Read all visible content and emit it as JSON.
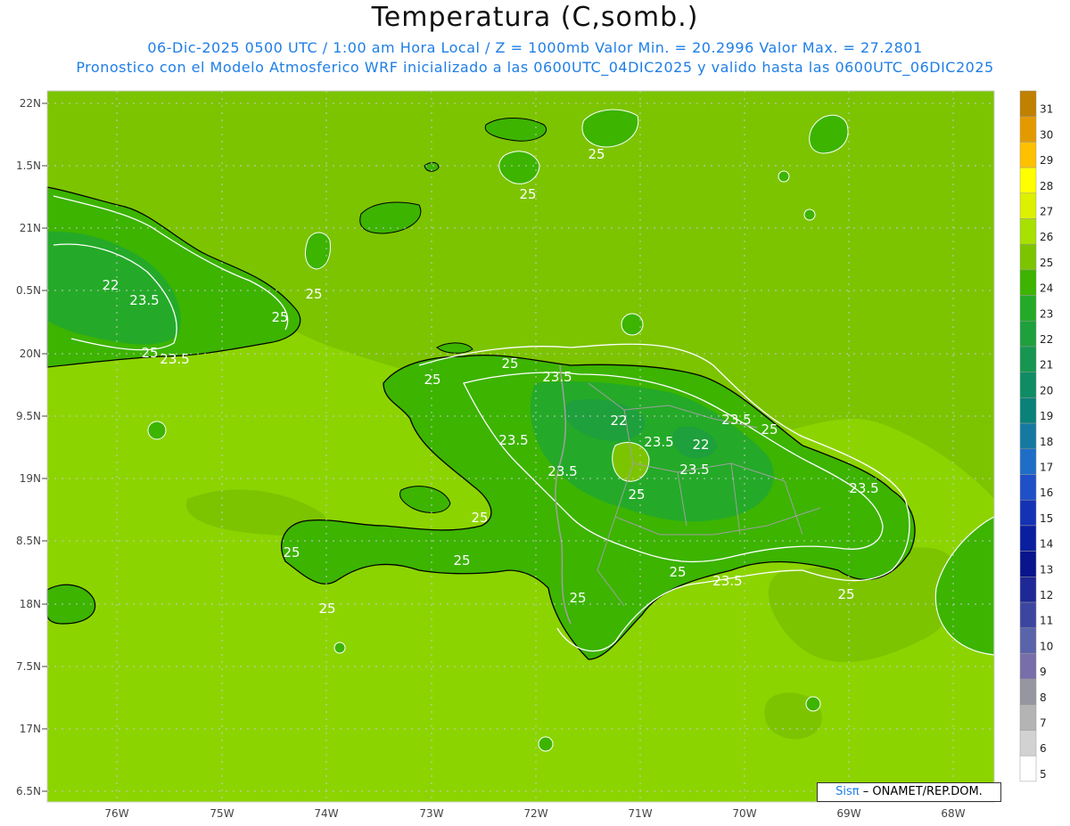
{
  "title": "Temperatura (C,somb.)",
  "subtitle_line1": "06-Dic-2025  0500 UTC / 1:00 am Hora Local / Z = 1000mb   Valor Min. = 20.2996  Valor Max. = 27.2801",
  "subtitle_line2": "Pronostico con el Modelo Atmosferico WRF inicializado a las 0600UTC_04DIC2025 y valido hasta las  0600UTC_06DIC2025",
  "credit": {
    "logo": "Sisπ",
    "text": "– ONAMET/REP.DOM."
  },
  "y_axis_labels": [
    "22N",
    "1.5N",
    "21N",
    "0.5N",
    "20N",
    "9.5N",
    "19N",
    "8.5N",
    "18N",
    "7.5N",
    "17N",
    "6.5N"
  ],
  "x_axis_labels": [
    "76W",
    "75W",
    "74W",
    "73W",
    "72W",
    "71W",
    "70W",
    "69W",
    "68W"
  ],
  "colorbar": {
    "levels": [
      "31",
      "30",
      "29",
      "28",
      "27",
      "26",
      "25",
      "24",
      "23",
      "22",
      "21",
      "20",
      "19",
      "18",
      "17",
      "16",
      "15",
      "14",
      "13",
      "12",
      "11",
      "10",
      "9",
      "8",
      "7",
      "6",
      "5"
    ],
    "colors": [
      "#c08000",
      "#e39a00",
      "#ffc000",
      "#ffff00",
      "#dcf000",
      "#a8e000",
      "#7cc400",
      "#3cb400",
      "#24aa28",
      "#1ea03c",
      "#169650",
      "#108c64",
      "#0a8278",
      "#167aa0",
      "#1e6ec8",
      "#1e50c8",
      "#1432b4",
      "#0a1ea0",
      "#0a148c",
      "#1e2896",
      "#3c46a0",
      "#5a64aa",
      "#786eaa",
      "#9696a0",
      "#b4b4b4",
      "#d2d2d2",
      "#ffffff"
    ]
  },
  "colors": {
    "sea_background": "#7cc400",
    "sea_warm": "#8cd400",
    "land_mid": "#3cb400",
    "land_cool": "#24aa28",
    "contour_line": "#ffffff",
    "coastline": "#000000",
    "border_line": "#a0a0a0"
  },
  "contour_labels": [
    "25",
    "25",
    "25",
    "25",
    "23.5",
    "23.5",
    "22",
    "25",
    "23.5",
    "25",
    "23.5",
    "22",
    "23.5",
    "22",
    "23.5",
    "23.5",
    "25",
    "25",
    "23.5",
    "23.5",
    "25",
    "25",
    "25",
    "25",
    "25",
    "25",
    "23.5",
    "25",
    "25"
  ]
}
